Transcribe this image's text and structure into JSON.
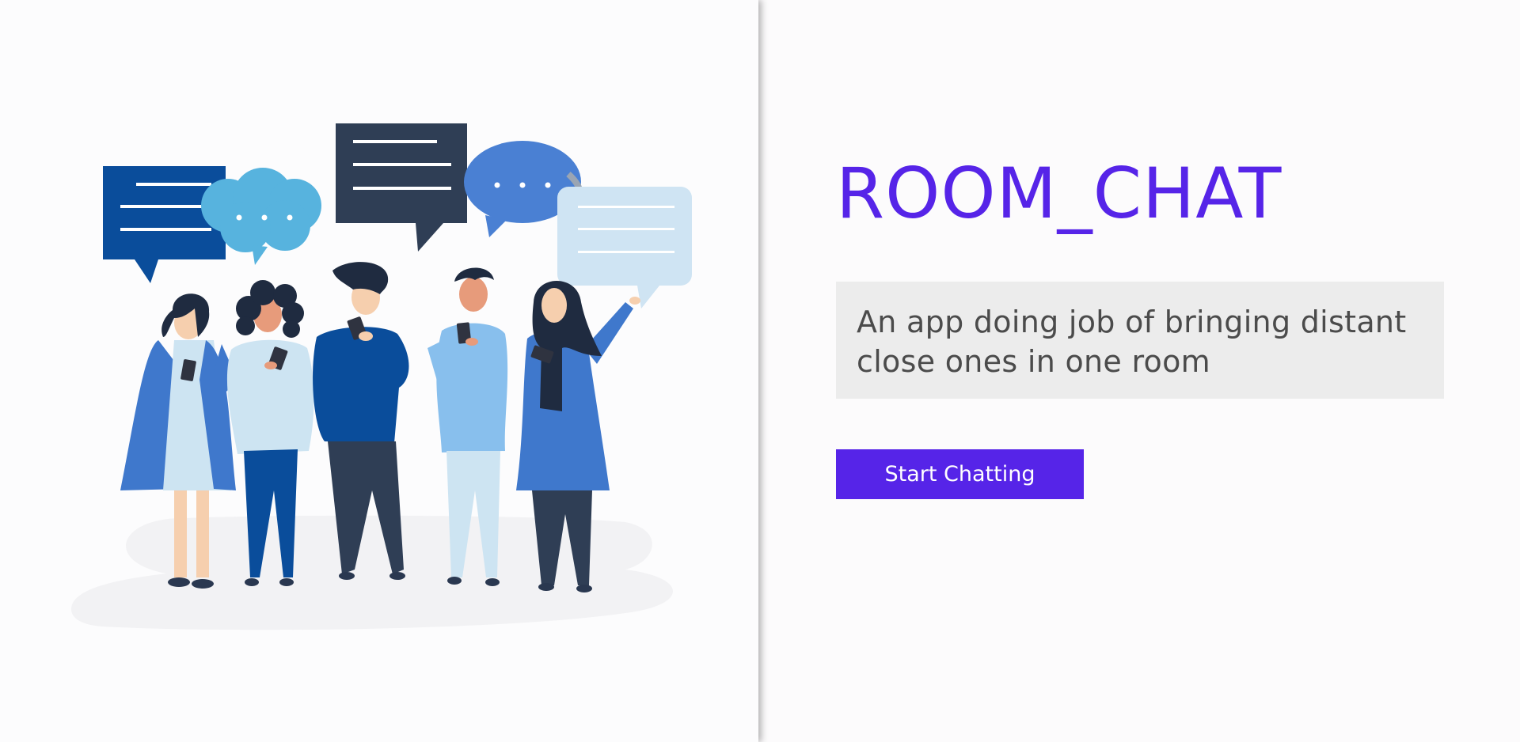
{
  "hero": {
    "title": "ROOM_CHAT",
    "tagline": "An app doing job of bringing distant close ones in one room",
    "cta_label": "Start Chatting"
  },
  "illustration": {
    "subject": "people-chatting-illustration"
  },
  "colors": {
    "accent": "#5624e8",
    "tagline_bg": "#ececec",
    "tagline_text": "#4b4b4b",
    "background": "#fcfbfc"
  }
}
